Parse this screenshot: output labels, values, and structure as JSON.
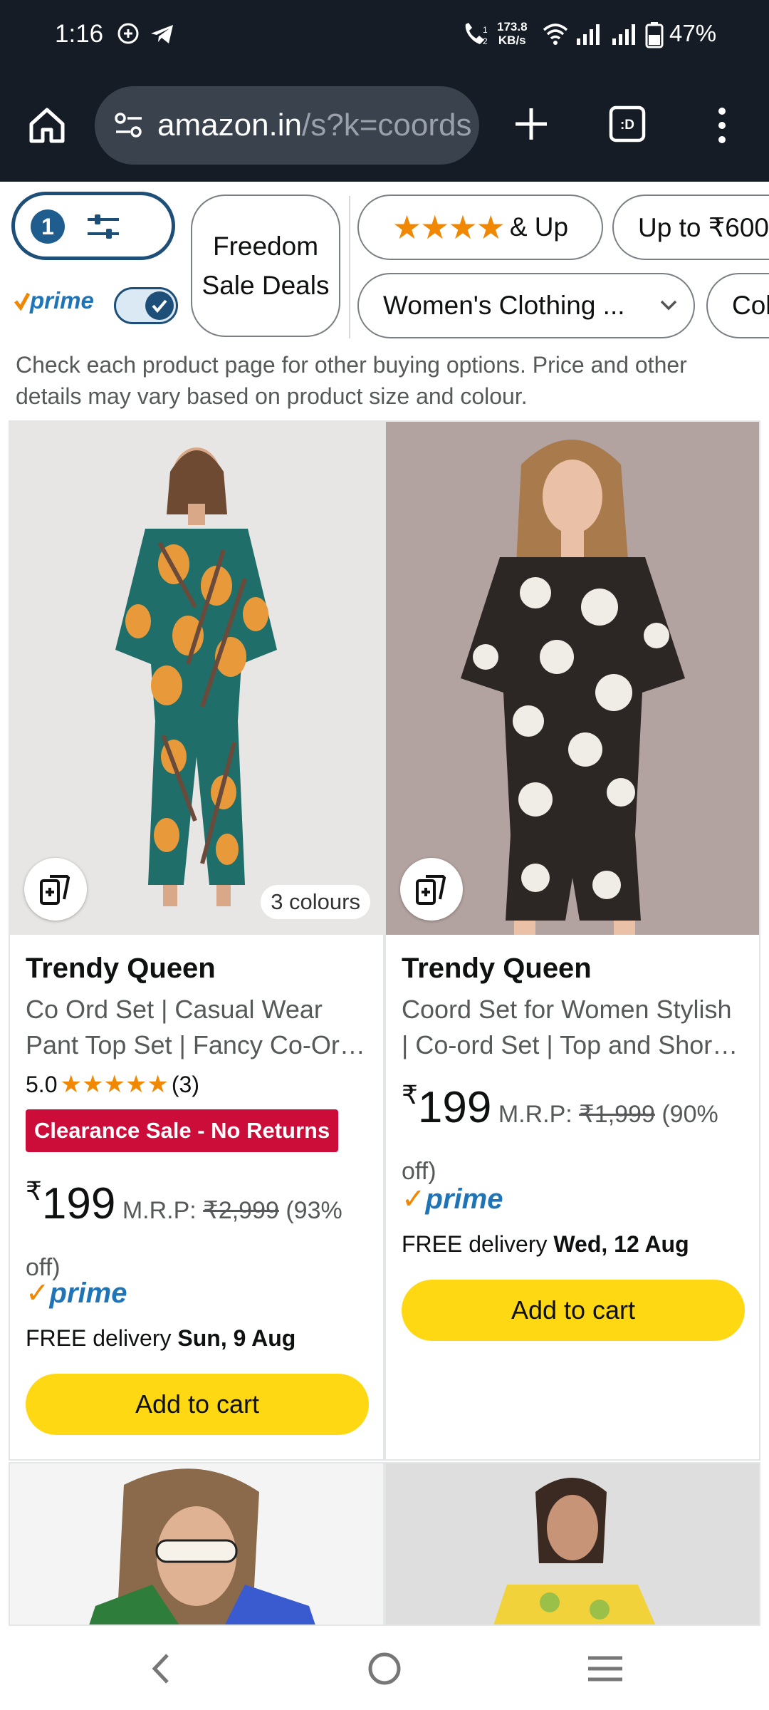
{
  "status_bar": {
    "time": "1:16",
    "net_speed_value": "173.8",
    "net_speed_unit": "KB/s",
    "battery": "47%"
  },
  "browser": {
    "url_host": "amazon.in",
    "url_path": "/s?k=coords"
  },
  "filters": {
    "active_count": "1",
    "prime_label": "prime",
    "chips": [
      {
        "label": "Freedom Sale Deals"
      },
      {
        "label": "& Up"
      },
      {
        "label": "Up to ₹600"
      },
      {
        "label": "Women's Clothing ..."
      },
      {
        "label": "Col"
      }
    ]
  },
  "info_text": "Check each product page for other buying options. Price and other details may vary based on product size and colour.",
  "products": [
    {
      "brand": "Trendy Queen",
      "title": "Co Ord Set | Casual Wear Pant Top Set | Fancy Co-Or…",
      "rating": "5.0",
      "rating_count": "(3)",
      "badge": "Clearance Sale - No Returns",
      "currency": "₹",
      "price": "199",
      "mrp_label": "M.R.P:",
      "mrp": "₹2,999",
      "discount": "(93%",
      "discount_tail": "off)",
      "prime": "prime",
      "delivery_prefix": "FREE delivery",
      "delivery_date": "Sun, 9 Aug",
      "colours": "3 colours",
      "cart": "Add to cart"
    },
    {
      "brand": "Trendy Queen",
      "title": "Coord Set for Women Stylish | Co-ord Set | Top and Shor…",
      "currency": "₹",
      "price": "199",
      "mrp_label": "M.R.P:",
      "mrp": "₹1,999",
      "discount": "(90%",
      "discount_tail": "off)",
      "prime": "prime",
      "delivery_prefix": "FREE delivery",
      "delivery_date": "Wed, 12 Aug",
      "cart": "Add to cart"
    }
  ],
  "colors": {
    "status_bg": "#151c26",
    "cart_button": "#ffd814",
    "clearance_badge": "#cc0c39",
    "prime_blue": "#1f74b8",
    "star": "#f08804"
  }
}
